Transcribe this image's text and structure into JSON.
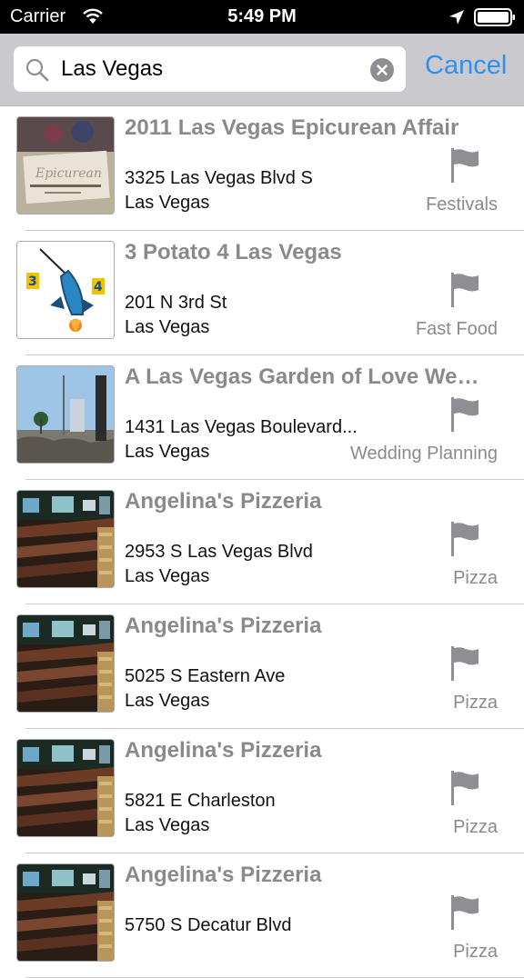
{
  "status_bar": {
    "carrier": "Carrier",
    "time": "5:49 PM"
  },
  "search": {
    "query": "Las Vegas",
    "cancel_label": "Cancel"
  },
  "results": [
    {
      "title": "2011 Las Vegas Epicurean Affair",
      "street": "3325 Las Vegas Blvd S",
      "city": "Las Vegas",
      "category": "Festivals",
      "thumb": "epicurean"
    },
    {
      "title": "3 Potato 4 Las Vegas",
      "street": "201 N 3rd St",
      "city": "Las Vegas",
      "category": "Fast Food",
      "thumb": "rocket"
    },
    {
      "title": "A Las Vegas Garden of Love We…",
      "street": "1431 Las Vegas Boulevard...",
      "city": "Las Vegas",
      "category": "Wedding Planning",
      "thumb": "street"
    },
    {
      "title": "Angelina's Pizzeria",
      "street": "2953 S Las Vegas Blvd",
      "city": "Las Vegas",
      "category": "Pizza",
      "thumb": "pizzeria"
    },
    {
      "title": "Angelina's Pizzeria",
      "street": "5025 S Eastern Ave",
      "city": "Las Vegas",
      "category": "Pizza",
      "thumb": "pizzeria"
    },
    {
      "title": "Angelina's Pizzeria",
      "street": "5821 E Charleston",
      "city": "Las Vegas",
      "category": "Pizza",
      "thumb": "pizzeria"
    },
    {
      "title": "Angelina's Pizzeria",
      "street": "5750 S Decatur Blvd",
      "city": "",
      "category": "Pizza",
      "thumb": "pizzeria"
    }
  ],
  "colors": {
    "accent": "#2f8ff4",
    "title_gray": "#8a8a8e",
    "search_bar_bg": "#c9c9ce"
  },
  "icons": {
    "search": "magnifier-icon",
    "clear": "clear-icon",
    "category": "flag-icon",
    "wifi": "wifi-icon",
    "location": "location-arrow-icon",
    "battery": "battery-icon"
  }
}
